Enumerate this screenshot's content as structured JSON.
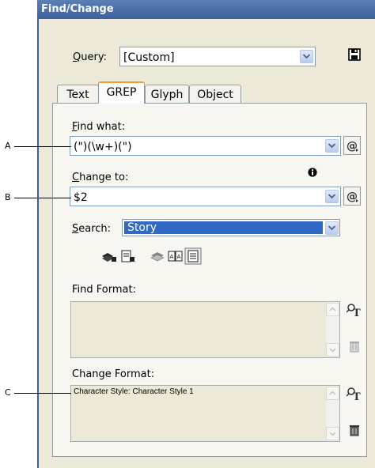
{
  "window": {
    "title": "Find/Change"
  },
  "query": {
    "label": "Query:",
    "label_accel": "Q",
    "label_rest": "uery:",
    "value": "[Custom]"
  },
  "tabs": [
    {
      "label": "Text"
    },
    {
      "label": "GREP",
      "active": true
    },
    {
      "label": "Glyph"
    },
    {
      "label": "Object"
    }
  ],
  "find_what": {
    "label_accel": "F",
    "label_rest": "ind what:",
    "value": "(\")(\\w+)(\")"
  },
  "change_to": {
    "label_accel": "C",
    "label_rest": "hange to:",
    "value": "$2"
  },
  "search": {
    "label_accel": "S",
    "label_rest": "earch:",
    "value": "Story"
  },
  "find_format": {
    "label": "Find Format:",
    "value": ""
  },
  "change_format": {
    "label": "Change Format:",
    "value": "Character Style: Character Style 1"
  },
  "callouts": {
    "a": "A",
    "b": "B",
    "c": "C"
  },
  "colors": {
    "title_bar": "#3d60a0",
    "selection": "#316ac5",
    "dialog_bg": "#ece9d8"
  },
  "icons": [
    "save-query-icon",
    "special-characters-icon",
    "info-icon",
    "include-locked-layers-icon",
    "include-locked-stories-icon",
    "include-hidden-layers-icon",
    "include-master-pages-icon",
    "include-footnotes-icon",
    "specify-attributes-icon",
    "clear-attributes-icon"
  ]
}
